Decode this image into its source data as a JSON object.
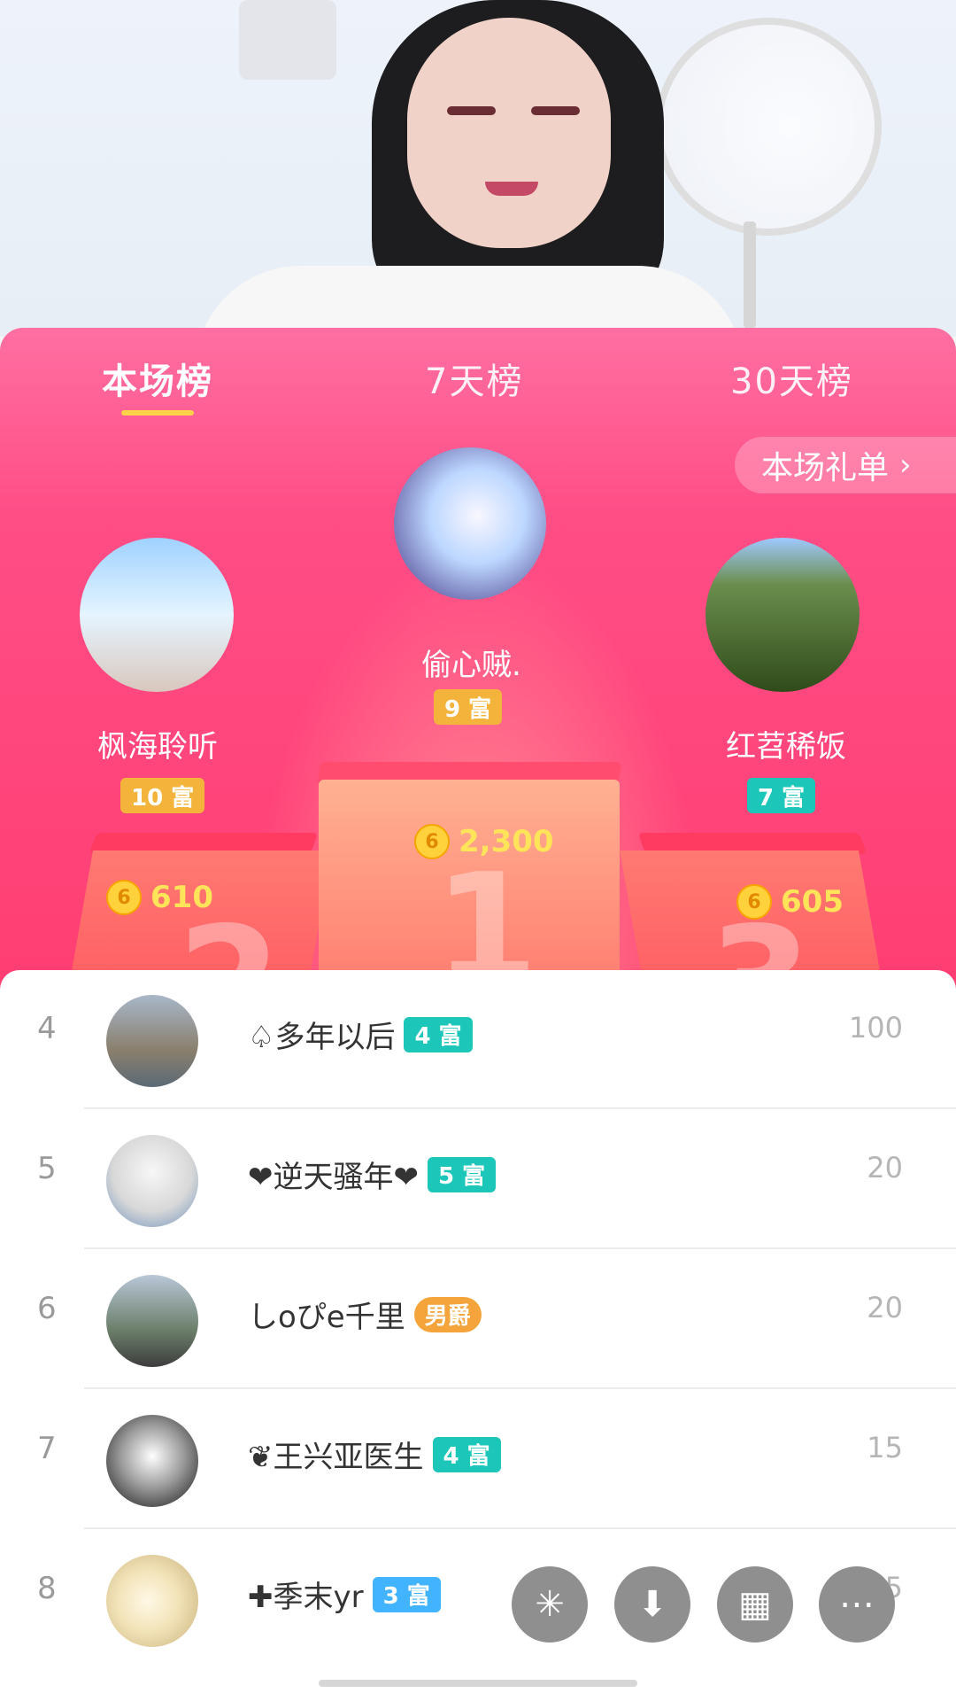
{
  "tabs": {
    "tab1": "本场榜",
    "tab2": "7天榜",
    "tab3": "30天榜"
  },
  "gift_list": {
    "label": "本场礼单",
    "chevron": "›"
  },
  "top3": {
    "first": {
      "name": "偷心贼.",
      "badge": "9 富",
      "coins": "2,300"
    },
    "second": {
      "name": "枫海聆听",
      "badge": "10 富",
      "coins": "610"
    },
    "third": {
      "name": "红苕稀饭",
      "badge": "7 富",
      "coins": "605"
    }
  },
  "podium": {
    "d1": "1",
    "d2": "2",
    "d3": "3"
  },
  "list": [
    {
      "rank": "4",
      "name": "♤多年以后",
      "tag": "4 富",
      "score": "100"
    },
    {
      "rank": "5",
      "name": "❤逆天骚年❤",
      "tag": "5 富",
      "score": "20"
    },
    {
      "rank": "6",
      "name": "しoぴe千里",
      "tag": "男爵",
      "score": "20"
    },
    {
      "rank": "7",
      "name": "❦王兴亚医生",
      "tag": "4 富",
      "score": "15"
    },
    {
      "rank": "8",
      "name": "✚季末yr",
      "tag": "3 富",
      "score": "15"
    }
  ],
  "icons": {
    "coin": "6",
    "fab1": "✳",
    "fab2": "⬇",
    "fab3": "▦",
    "fab4": "⋯"
  },
  "colors": {
    "panel_pink": "#ff4d86",
    "badge_gold": "#f4b43b",
    "badge_teal": "#1cc6b9",
    "badge_blue": "#42b4ff"
  }
}
